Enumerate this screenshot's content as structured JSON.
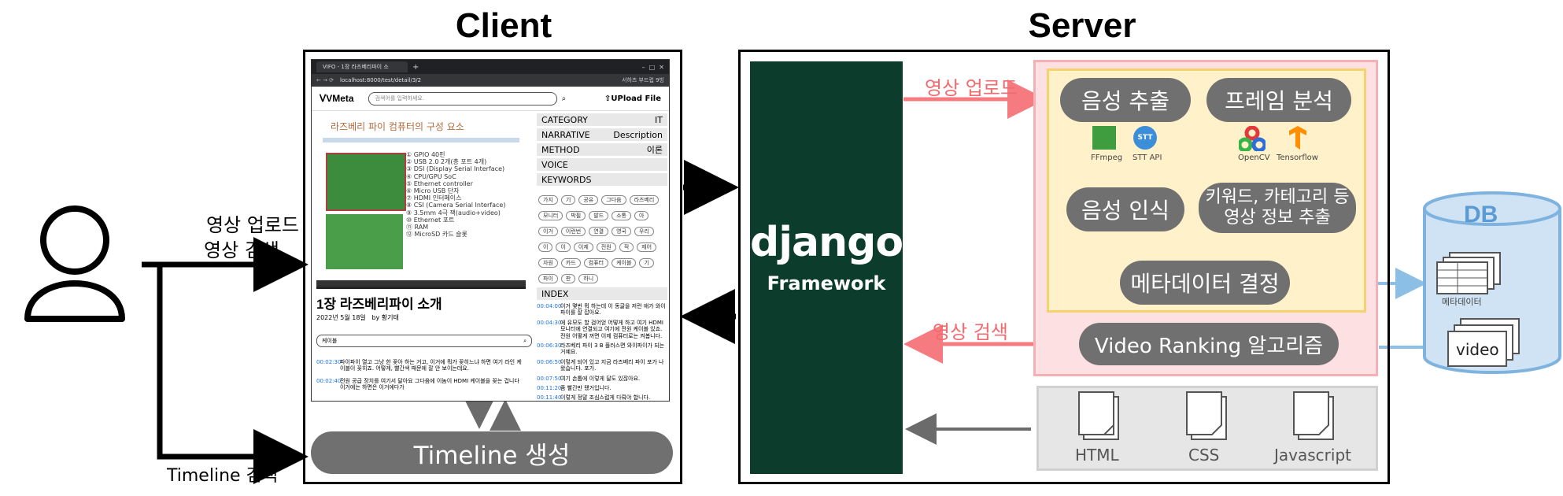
{
  "titles": {
    "client": "Client",
    "server": "Server"
  },
  "user": {
    "upload_label": "영상 업로드",
    "search_label": "영상 검색",
    "timeline_search_label": "Timeline 검색"
  },
  "client": {
    "timeline_label": "Timeline 생성",
    "browser": {
      "tab_title": "VIFO - 1장 라즈베리파이 소",
      "url": "localhost:8000/test/detail/3/2",
      "account": "서하츠 부드럽 9빙",
      "logo": "VMeta",
      "search_placeholder": "검색어를 입력하세요.",
      "upload_button": "UPload File",
      "slide_title": "라즈베리 파이 컴퓨터의 구성 요소",
      "slide_items": [
        "① GPIO 40핀",
        "② USB 2.0 2개(총 포트 4개)",
        "③ DSI (Display Serial Interface)",
        "④ CPU/GPU SoC",
        "⑤ Ethernet controller",
        "⑥ Micro USB 단자",
        "⑦ HDMI 인터페이스",
        "⑧ CSI (Camera Serial Interface)",
        "⑨ 3.5mm 4극 잭(audio+video)",
        "⑩ Ethernet 포트",
        "⑪ RAM",
        "⑫ MicroSD 카드 슬롯"
      ],
      "video_title": "1장 라즈베리파이 소개",
      "video_date": "2022년 5월 18일",
      "video_author": "by 황기태",
      "search_box_value": "케이블",
      "results": [
        {
          "time": "00:02:30",
          "text": "파이파이 열고 그냥 한 꽂아 하는 거고, 이거에 뭐가 꽂히느냐 하면 여기 라인 케이블이 꽂히죠. 어떻게, 빨간색 때문에 잘 안 보이는데요."
        },
        {
          "time": "00:02:40",
          "text": "전원 공급 장치를 여기서 달아요 그다음에 이놈이 HDMI 케이블을 꽂는 겁니다 이거에는 하면은 이거에다가"
        }
      ],
      "meta": [
        {
          "key": "CATEGORY",
          "value": "IT"
        },
        {
          "key": "NARRATIVE",
          "value": "Description"
        },
        {
          "key": "METHOD",
          "value": "이론"
        },
        {
          "key": "VOICE",
          "value": ""
        },
        {
          "key": "KEYWORDS",
          "value": ""
        }
      ],
      "keywords": [
        "가지",
        "기",
        "공유",
        "그다음",
        "라즈베리",
        "모니터",
        "박필",
        "발드",
        "소통",
        "아",
        "이거",
        "이런번",
        "연결",
        "영국",
        "우리",
        "이",
        "이",
        "이제",
        "전원",
        "적",
        "제어",
        "자원",
        "카드",
        "컴퓨터",
        "케이블",
        "기",
        "파이",
        "판",
        "하니"
      ],
      "index_label": "INDEX",
      "index": [
        {
          "time": "00:04:00",
          "text": "이거 몇번 뭐 하는데 이 동글을 저런 애가 와이파이를 잘 잡아요."
        },
        {
          "time": "00:04:30",
          "text": "에 유모도 할 검어얻 어떻게 하고 여기 HDMI 모니터에 연결되고 여기에 전원 케이블 있죠. 전원 어떻게 꺼면 이제 컴퓨터로는 켜봅니다."
        },
        {
          "time": "00:06:30",
          "text": "라즈베리 파이 3 B 플러스면 와이파이가 되는 거예요."
        },
        {
          "time": "00:06:50",
          "text": "이렇게 되어 있고 지금 라즈베리 파이 포가 나왔습니다. 포가."
        },
        {
          "time": "00:07:50",
          "text": "여기 손톱에 이렇게 달도 있잖아요."
        },
        {
          "time": "00:11:20",
          "text": "좀 빨간만 됐거입니다."
        },
        {
          "time": "00:11:40",
          "text": "이렇게 정말 조심스럽게 다뤄야 합니다."
        }
      ]
    }
  },
  "server": {
    "django_logo": "django",
    "django_sub": "Framework",
    "upload_label": "영상 업로드",
    "search_label": "영상 검색",
    "audio_extract": "음성 추출",
    "frame_analysis": "프레임 분석",
    "speech_recognition": "음성 인식",
    "keyword_extract_line1": "키워드, 카테고리 등",
    "keyword_extract_line2": "영상 정보 추출",
    "metadata_decide": "메타데이터 결정",
    "ranking": "Video Ranking 알고리즘",
    "tools": {
      "ffmpeg": "FFmpeg",
      "stt_badge": "STT",
      "stt": "STT API",
      "opencv": "OpenCV",
      "tensorflow": "Tensorflow"
    },
    "files": {
      "html": "HTML",
      "css": "CSS",
      "js": "Javascript"
    }
  },
  "db": {
    "title": "DB",
    "metadata_label": "메타데이터",
    "video_label": "video"
  },
  "colors": {
    "django_green": "#0c3c2b",
    "pink_bg": "#fde0e2",
    "pink_border": "#f4b0b4",
    "yellow_bg": "#fff1c9",
    "yellow_border": "#f6d26e",
    "gray_pill": "#707070",
    "red_arrow": "#f57b80",
    "blue_db": "#cfe3f5",
    "blue_db_border": "#7fb3df",
    "blue_db_text": "#5a9bd5"
  }
}
